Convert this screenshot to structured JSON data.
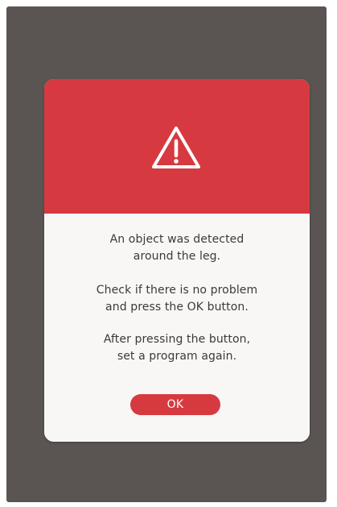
{
  "dialog": {
    "icon": "warning-triangle-icon",
    "message_lines": [
      "An object was detected",
      "around the leg.",
      "Check if there is no problem",
      "and press the OK button.",
      "After pressing the button,",
      "set a program again."
    ],
    "ok_label": "OK"
  },
  "colors": {
    "screen_background": "#5a5553",
    "accent_red": "#d63a40",
    "dialog_body": "#f8f7f6",
    "text": "#3a3a3a",
    "button_text": "#ffffff"
  }
}
